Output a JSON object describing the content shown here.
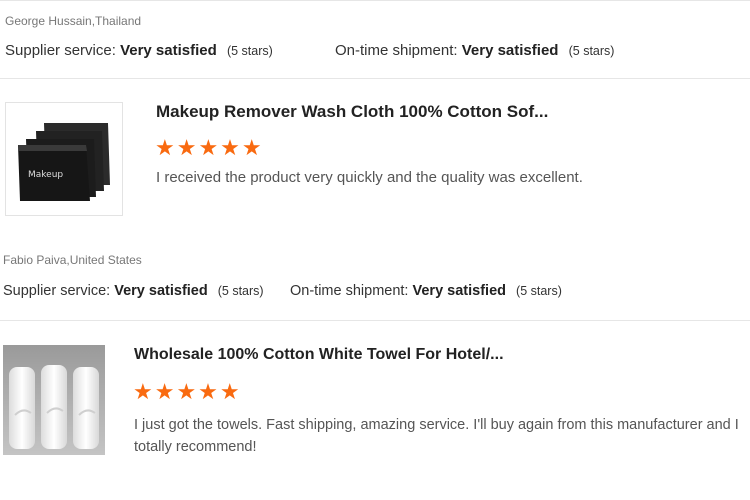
{
  "reviews": [
    {
      "reviewer": "George Hussain,Thailand",
      "supplier_service_label": "Supplier service:",
      "supplier_service_value": "Very satisfied",
      "supplier_service_count": "(5 stars)",
      "shipment_label": "On-time shipment:",
      "shipment_value": "Very satisfied",
      "shipment_count": "(5 stars)",
      "product_title": "Makeup Remover Wash Cloth 100% Cotton Sof...",
      "product_image_text": "Makeup",
      "stars": "★★★★★",
      "rating": 5,
      "text": "I received the product very quickly and the quality was excellent."
    },
    {
      "reviewer": "Fabio Paiva,United States",
      "supplier_service_label": "Supplier service:",
      "supplier_service_value": "Very satisfied",
      "supplier_service_count": "(5 stars)",
      "shipment_label": "On-time shipment:",
      "shipment_value": "Very satisfied",
      "shipment_count": "(5 stars)",
      "product_title": "Wholesale 100% Cotton White Towel For Hotel/...",
      "stars": "★★★★★",
      "rating": 5,
      "text": "I just got the towels. Fast shipping, amazing service. I'll buy again from this manufacturer and I totally recommend!"
    }
  ],
  "colors": {
    "star": "#f96a10",
    "divider": "#e6e6e6"
  }
}
